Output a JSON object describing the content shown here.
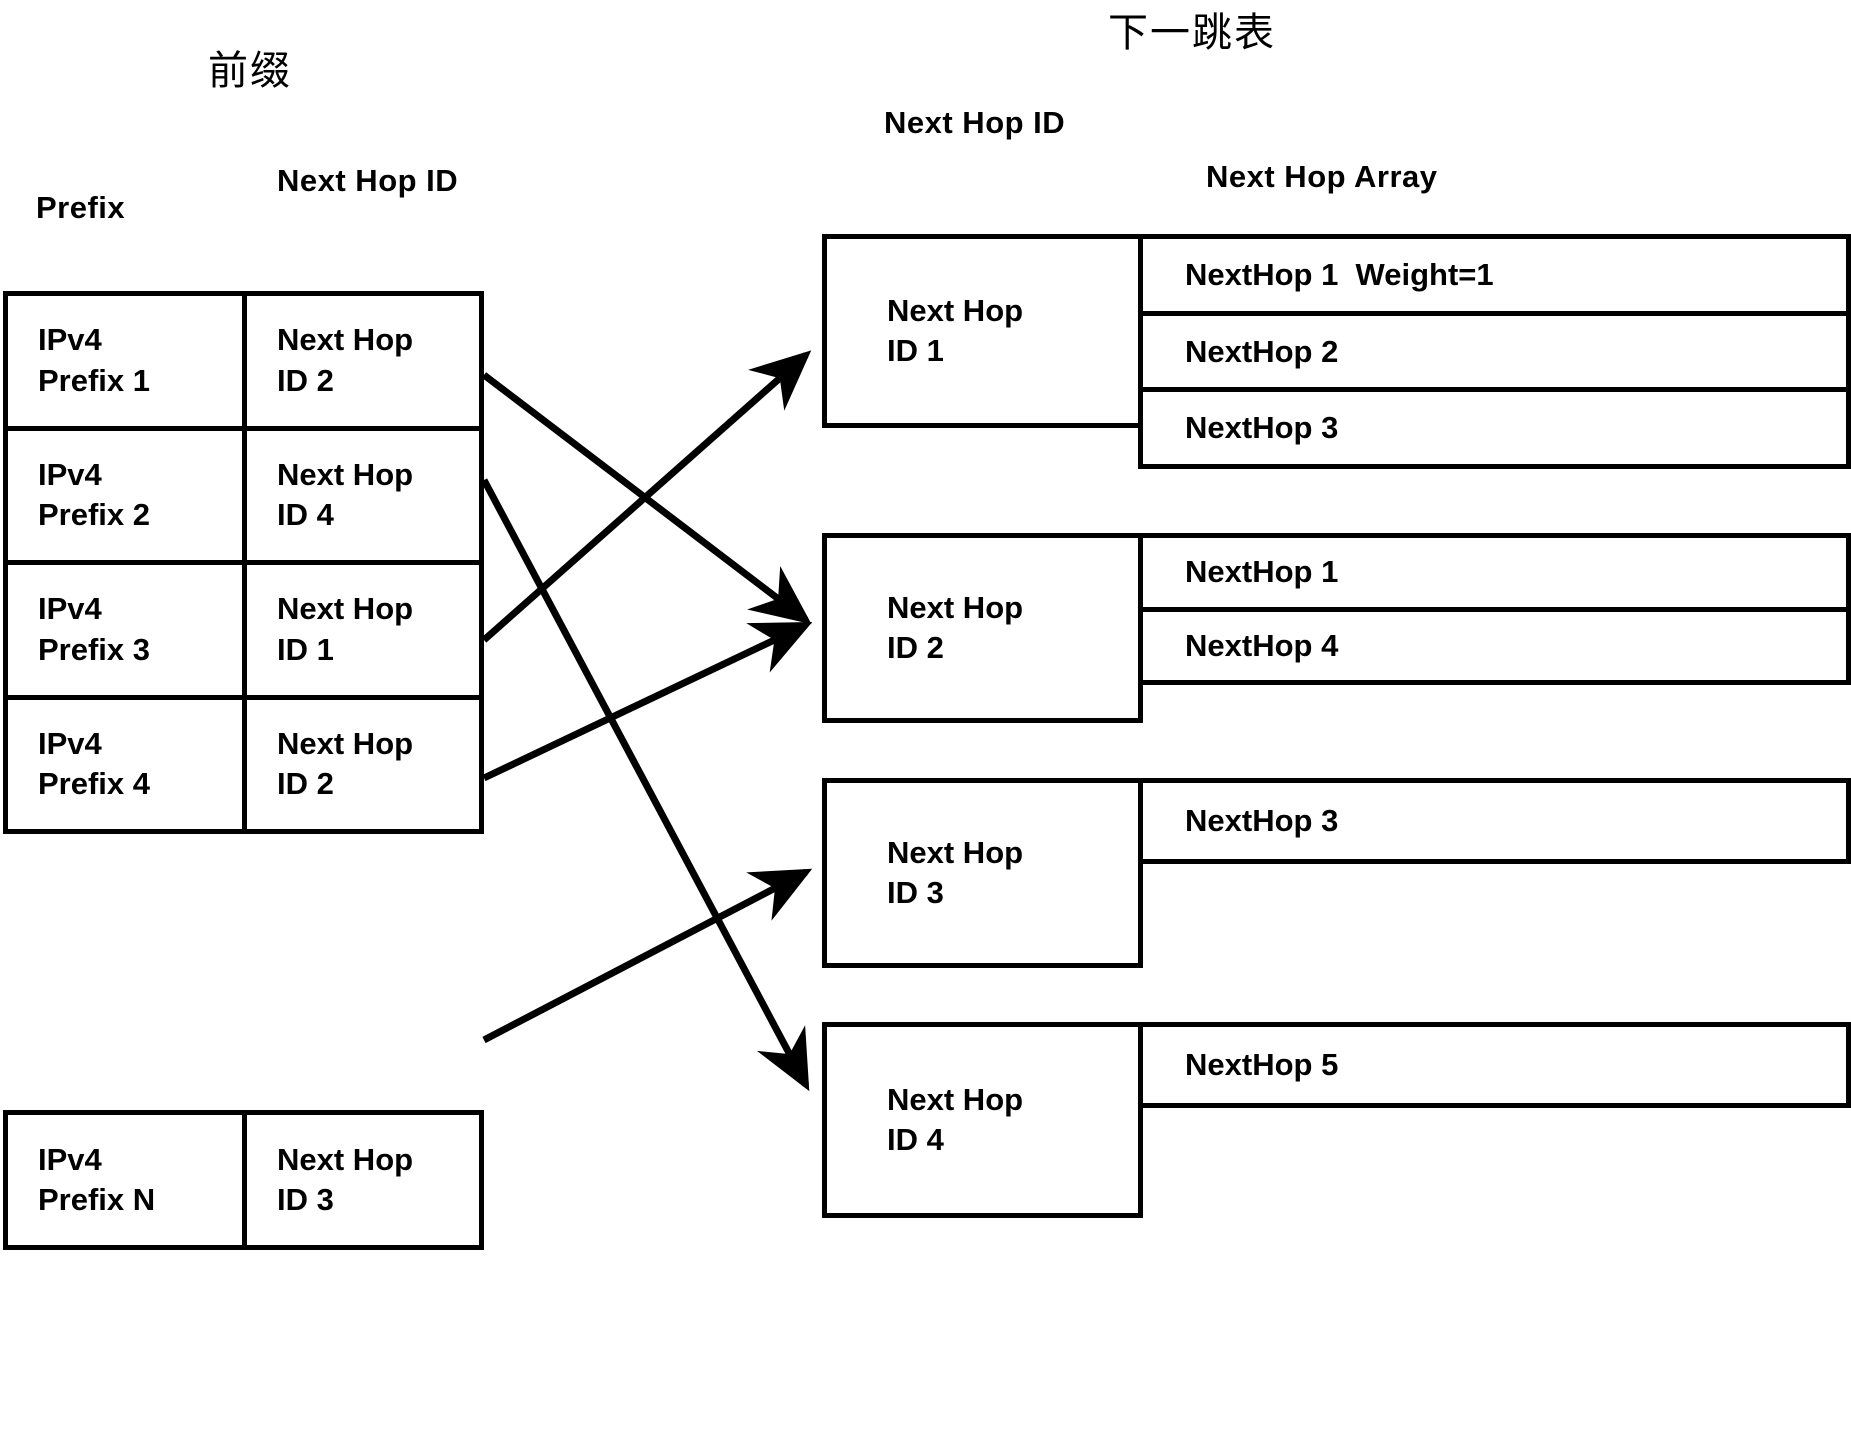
{
  "titles": {
    "left_cjk": "前缀",
    "right_cjk": "下一跳表"
  },
  "left_table": {
    "col_headers": {
      "prefix": "Prefix",
      "next_hop_id": "Next Hop\nID"
    },
    "rows": [
      {
        "prefix": "IPv4\nPrefix 1",
        "next_hop_id": "Next Hop\nID 2"
      },
      {
        "prefix": "IPv4\nPrefix 2",
        "next_hop_id": "Next Hop\nID 4"
      },
      {
        "prefix": "IPv4\nPrefix 3",
        "next_hop_id": "Next Hop\nID 1"
      },
      {
        "prefix": "IPv4\nPrefix 4",
        "next_hop_id": "Next Hop\nID 2"
      }
    ],
    "last_row": {
      "prefix": "IPv4\nPrefix N",
      "next_hop_id": "Next Hop\nID 3"
    }
  },
  "right_table": {
    "col_headers": {
      "next_hop_id": "Next Hop\nID",
      "next_hop_array": "Next Hop Array"
    },
    "blocks": [
      {
        "id_label": "Next Hop\nID 1",
        "array": [
          "NextHop 1  Weight=1",
          "NextHop 2",
          "NextHop 3"
        ]
      },
      {
        "id_label": "Next Hop\nID 2",
        "array": [
          "NextHop 1",
          "NextHop 4"
        ]
      },
      {
        "id_label": "Next Hop\nID 3",
        "array": [
          "NextHop 3"
        ]
      },
      {
        "id_label": "Next Hop\nID 4",
        "array": [
          "NextHop 5"
        ]
      }
    ]
  },
  "connections": [
    {
      "from": "IPv4 Prefix 1",
      "to": "Next Hop ID 2"
    },
    {
      "from": "IPv4 Prefix 2",
      "to": "Next Hop ID 4"
    },
    {
      "from": "IPv4 Prefix 3",
      "to": "Next Hop ID 1"
    },
    {
      "from": "IPv4 Prefix 4",
      "to": "Next Hop ID 2"
    },
    {
      "from": "IPv4 Prefix N",
      "to": "Next Hop ID 3"
    }
  ],
  "colors": {
    "stroke": "#000000",
    "background": "#ffffff"
  }
}
